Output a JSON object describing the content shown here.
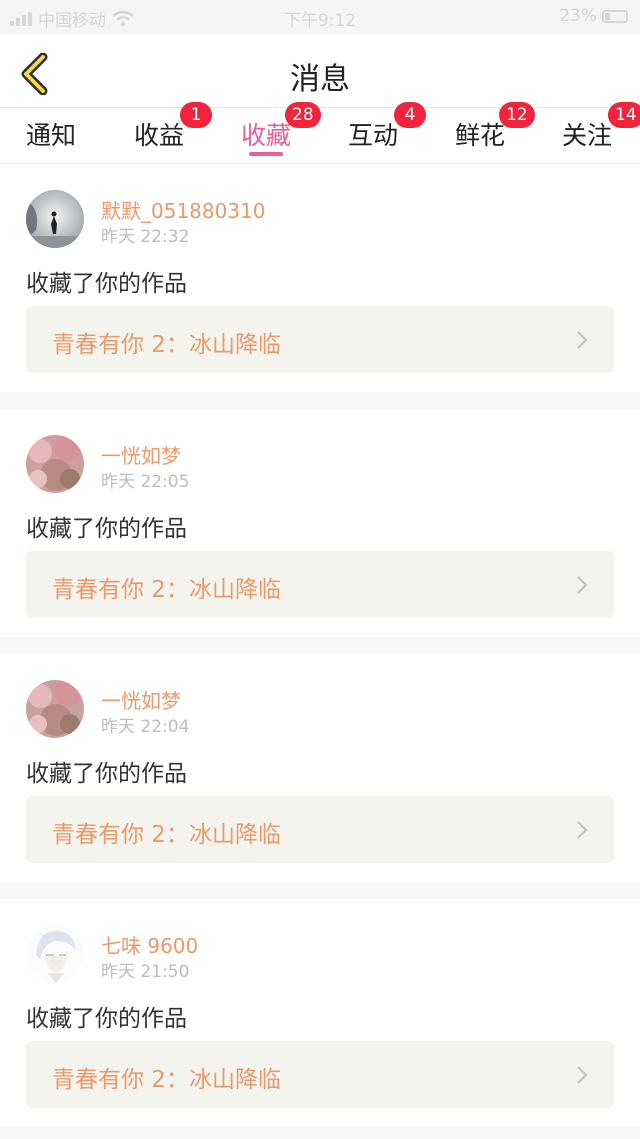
{
  "status_bar": {
    "carrier": "中国移动",
    "time": "下午9:12",
    "battery": "23%"
  },
  "nav": {
    "title": "消息"
  },
  "tabs": [
    {
      "label": "通知",
      "badge": ""
    },
    {
      "label": "收益",
      "badge": "1"
    },
    {
      "label": "收藏",
      "badge": "28",
      "active": true
    },
    {
      "label": "互动",
      "badge": "4"
    },
    {
      "label": "鲜花",
      "badge": "12"
    },
    {
      "label": "关注",
      "badge": "14"
    }
  ],
  "items": [
    {
      "username": "默默_051880310",
      "time": "昨天 22:32",
      "action": "收藏了你的作品",
      "work": "青春有你 2：冰山降临"
    },
    {
      "username": "一恍如梦",
      "time": "昨天 22:05",
      "action": "收藏了你的作品",
      "work": "青春有你 2：冰山降临"
    },
    {
      "username": "一恍如梦",
      "time": "昨天 22:04",
      "action": "收藏了你的作品",
      "work": "青春有你 2：冰山降临"
    },
    {
      "username": "七味 9600",
      "time": "昨天 21:50",
      "action": "收藏了你的作品",
      "work": "青春有你 2：冰山降临"
    }
  ],
  "colors": {
    "accent": "#e8609a",
    "badge": "#f0243c",
    "username": "#ea9a6a"
  }
}
